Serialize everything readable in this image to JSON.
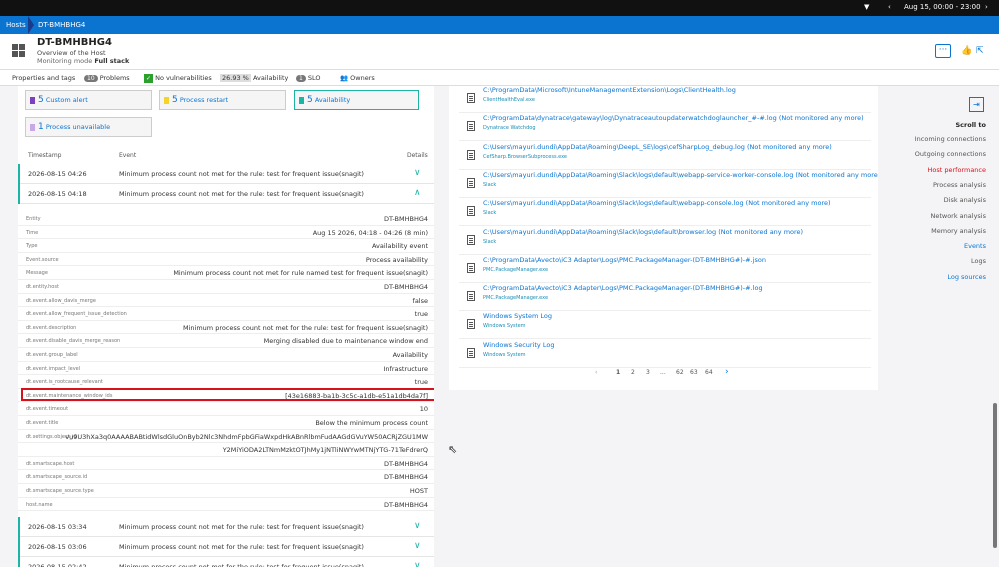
{
  "topbar": {
    "filter_icon": "filter-icon",
    "date_range": "Aug 15, 00:00 - 23:00"
  },
  "breadcrumb": {
    "root": "Hosts",
    "current": "DT-BMHBHG4"
  },
  "header": {
    "title": "DT-BMHBHG4",
    "subtitle": "Overview of the Host",
    "mode_label": "Monitoring mode",
    "mode_value": "Full stack",
    "more": "···"
  },
  "tags": {
    "properties": "Properties and tags",
    "problems_count": "10",
    "problems": "Problems",
    "vulnerabilities": "No vulnerabilities",
    "availability_pct": "26.93 %",
    "availability": "Availability",
    "slo_count": "1",
    "slo": "SLO",
    "owners": "Owners"
  },
  "tiles": [
    {
      "num": "5",
      "label": "Custom alert",
      "color": "#7c3fbf"
    },
    {
      "num": "5",
      "label": "Process restart",
      "color": "#f5d327"
    },
    {
      "num": "5",
      "label": "Availability",
      "color": "#1bb4a5"
    },
    {
      "num": "1",
      "label": "Process unavailable",
      "color": "#c9a8e8"
    }
  ],
  "events_table": {
    "col_timestamp": "Timestamp",
    "col_event": "Event",
    "col_details": "Details",
    "rows_top": [
      {
        "ts": "2026-08-15 04:26",
        "msg": "Minimum process count not met for the rule: test for frequent issue(snagit)"
      },
      {
        "ts": "2026-08-15 04:18",
        "msg": "Minimum process count not met for the rule: test for frequent issue(snagit)"
      }
    ],
    "properties": [
      {
        "k": "Entity",
        "v": "DT-BMHBHG4"
      },
      {
        "k": "Time",
        "v": "Aug 15 2026, 04:18 - 04:26 (8 min)"
      },
      {
        "k": "Type",
        "v": "Availability event"
      },
      {
        "k": "Event.source",
        "v": "Process availability"
      },
      {
        "k": "Message",
        "v": "Minimum process count not met for rule named test for frequent issue(snagit)"
      },
      {
        "k": "dt.entity.host",
        "v": "DT-BMHBHG4"
      },
      {
        "k": "dt.event.allow_davis_merge",
        "v": "false"
      },
      {
        "k": "dt.event.allow_frequent_issue_detection",
        "v": "true"
      },
      {
        "k": "dt.event.description",
        "v": "Minimum process count not met for the rule: test for frequent issue(snagit)"
      },
      {
        "k": "dt.event.disable_davis_merge_reason",
        "v": "Merging disabled due to maintenance window end"
      },
      {
        "k": "dt.event.group_label",
        "v": "Availability"
      },
      {
        "k": "dt.event.impact_level",
        "v": "Infrastructure"
      },
      {
        "k": "dt.event.is_rootcause_relevant",
        "v": "true"
      },
      {
        "k": "dt.event.maintenance_window_ids",
        "v": "[43e16883-ba1b-3c5c-a1db-e51a1db4da7f]"
      },
      {
        "k": "dt.event.timeout",
        "v": "10"
      },
      {
        "k": "dt.event.title",
        "v": "Below the minimum process count"
      },
      {
        "k": "dt.settings.object_id",
        "v": "vu9U3hXa3q0AAAABABtidWlsdGluOnByb2Nlc3NhdmFpbGFiaWxpdHkABnRlbmFudAAGdGVuYW50ACRjZGU1MW"
      },
      {
        "k": "",
        "v": "Y2MiYiODA2LTNmMzktOTJhMy1jNTliNWYwMTNjYTG-71TeFdrerQ"
      },
      {
        "k": "dt.smartscape.host",
        "v": "DT-BMHBHG4"
      },
      {
        "k": "dt.smartscape_source.id",
        "v": "DT-BMHBHG4"
      },
      {
        "k": "dt.smartscape_source.type",
        "v": "HOST"
      },
      {
        "k": "host.name",
        "v": "DT-BMHBHG4"
      }
    ],
    "rows_bottom": [
      {
        "ts": "2026-08-15 03:34",
        "msg": "Minimum process count not met for the rule: test for frequent issue(snagit)"
      },
      {
        "ts": "2026-08-15 03:06",
        "msg": "Minimum process count not met for the rule: test for frequent issue(snagit)"
      },
      {
        "ts": "2026-08-15 02:42",
        "msg": "Minimum process count not met for the rule: test for frequent issue(snagit)"
      }
    ]
  },
  "logs": [
    {
      "path": "C:\\ProgramData\\Microsoft\\IntuneManagementExtension\\Logs\\ClientHealth.log",
      "proc": "ClientHealthEval.exe"
    },
    {
      "path": "C:\\ProgramData\\dynatrace\\gateway\\log\\Dynatraceautoupdaterwatchdoglauncher_#-#.log (Not monitored any more)",
      "proc": "Dynatrace Watchdog"
    },
    {
      "path": "C:\\Users\\mayuri.dundi\\AppData\\Roaming\\DeepL_SE\\logs\\cefSharpLog_debug.log (Not monitored any more)",
      "proc": "CefSharp.BrowserSubprocess.exe"
    },
    {
      "path": "C:\\Users\\mayuri.dundi\\AppData\\Roaming\\Slack\\logs\\default\\webapp-service-worker-console.log (Not monitored any more)",
      "proc": "Slack"
    },
    {
      "path": "C:\\Users\\mayuri.dundi\\AppData\\Roaming\\Slack\\logs\\default\\webapp-console.log (Not monitored any more)",
      "proc": "Slack"
    },
    {
      "path": "C:\\Users\\mayuri.dundi\\AppData\\Roaming\\Slack\\logs\\default\\browser.log (Not monitored any more)",
      "proc": "Slack"
    },
    {
      "path": "C:\\ProgramData\\Avecto\\iC3 Adapter\\Logs\\PMC.PackageManager-(DT-BMHBHG#)-#.json",
      "proc": "PMC.PackageManager.exe"
    },
    {
      "path": "C:\\ProgramData\\Avecto\\iC3 Adapter\\Logs\\PMC.PackageManager-(DT-BMHBHG#)-#.log",
      "proc": "PMC.PackageManager.exe"
    },
    {
      "path": "Windows System Log",
      "proc": "Windows System"
    },
    {
      "path": "Windows Security Log",
      "proc": "Windows System"
    }
  ],
  "pager": {
    "prev": "‹",
    "pages": [
      "1",
      "2",
      "3",
      "...",
      "62",
      "63",
      "64"
    ],
    "next": "›"
  },
  "scroll_to": {
    "title": "Scroll to",
    "items": [
      {
        "label": "Incoming connections",
        "color": "#555"
      },
      {
        "label": "Outgoing connections",
        "color": "#555"
      },
      {
        "label": "Host performance",
        "color": "#d8121b"
      },
      {
        "label": "Process analysis",
        "color": "#555"
      },
      {
        "label": "Disk analysis",
        "color": "#555"
      },
      {
        "label": "Network analysis",
        "color": "#555"
      },
      {
        "label": "Memory analysis",
        "color": "#555"
      },
      {
        "label": "Events",
        "color": "#0b74d0"
      },
      {
        "label": "Logs",
        "color": "#555"
      },
      {
        "label": "Log sources",
        "color": "#0b74d0"
      }
    ]
  }
}
